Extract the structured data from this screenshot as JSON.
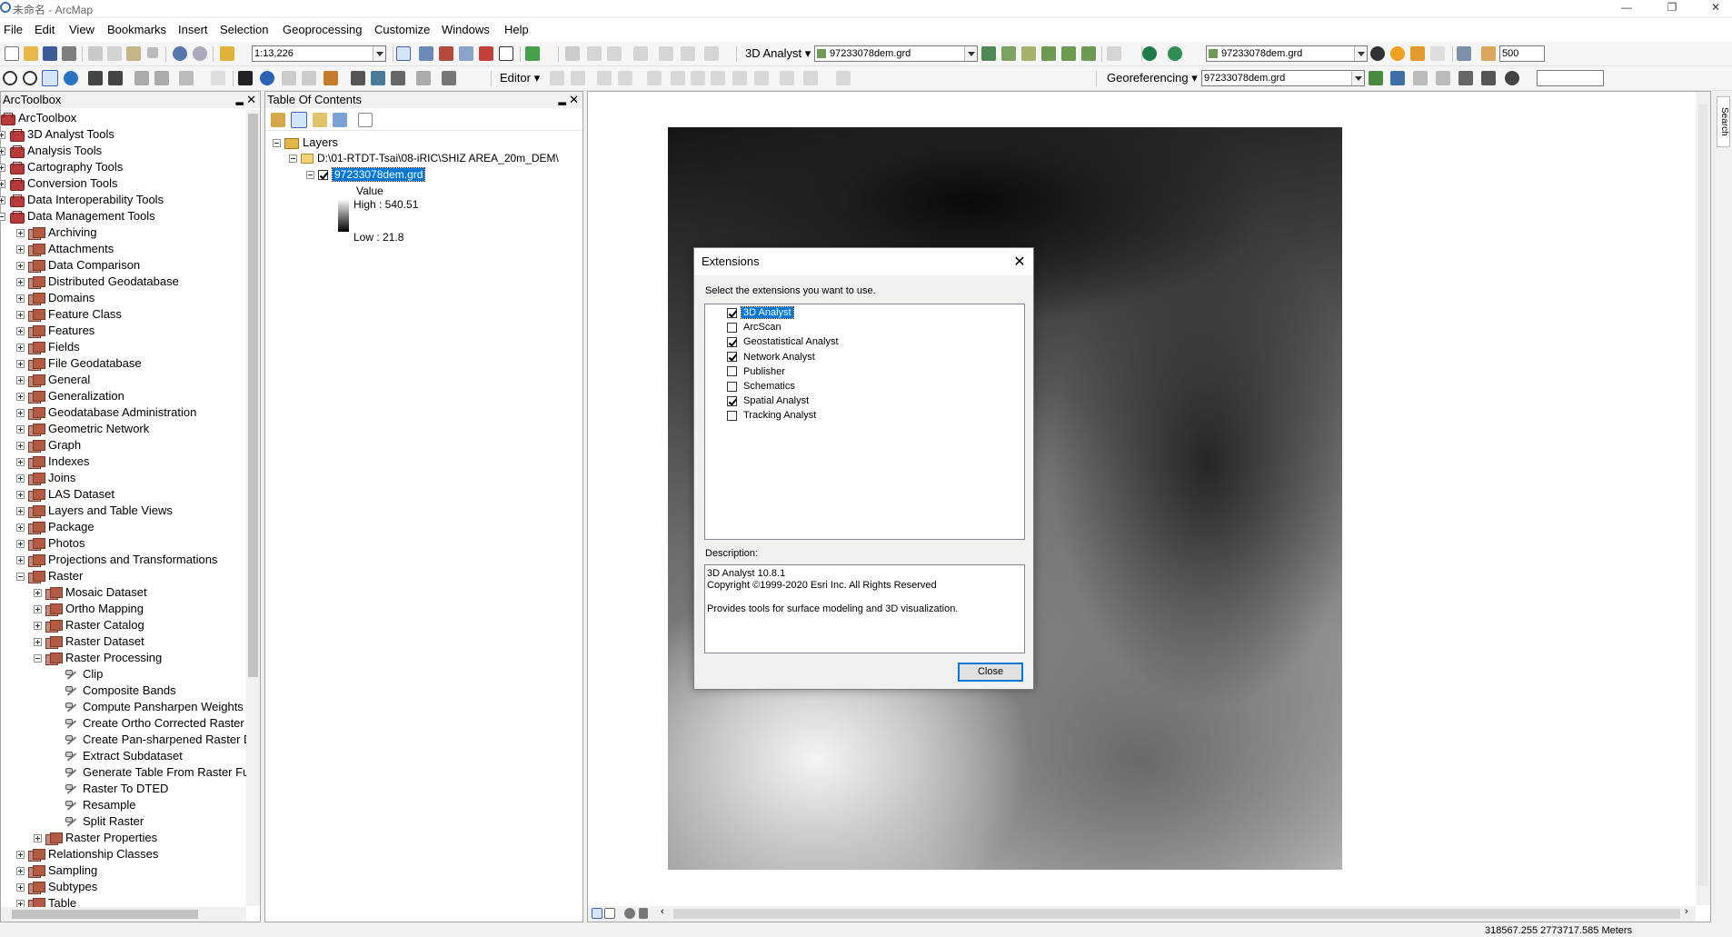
{
  "window": {
    "title": "未命名 - ArcMap",
    "controls": [
      "—",
      "❐",
      "✕"
    ]
  },
  "menu": [
    "File",
    "Edit",
    "View",
    "Bookmarks",
    "Insert",
    "Selection",
    "Geoprocessing",
    "Customize",
    "Windows",
    "Help"
  ],
  "toolbar": {
    "scale": "1:13,226",
    "analyst_label": "3D Analyst",
    "analyst_layer": "97233078dem.grd",
    "spatial_layer": "97233078dem.grd",
    "resolution": "500",
    "editor_label": "Editor",
    "georef_label": "Georeferencing",
    "georef_layer": "97233078dem.grd"
  },
  "toolbox": {
    "title": "ArcToolbox",
    "root": "ArcToolbox",
    "top_items": [
      "3D Analyst Tools",
      "Analysis Tools",
      "Cartography Tools",
      "Conversion Tools",
      "Data Interoperability Tools",
      "Data Management Tools"
    ],
    "dm_items_before_raster": [
      "Archiving",
      "Attachments",
      "Data Comparison",
      "Distributed Geodatabase",
      "Domains",
      "Feature Class",
      "Features",
      "Fields",
      "File Geodatabase",
      "General",
      "Generalization",
      "Geodatabase Administration",
      "Geometric Network",
      "Graph",
      "Indexes",
      "Joins",
      "LAS Dataset",
      "Layers and Table Views",
      "Package",
      "Photos",
      "Projections and Transformations"
    ],
    "raster": "Raster",
    "raster_items": [
      "Mosaic Dataset",
      "Ortho Mapping",
      "Raster Catalog",
      "Raster Dataset"
    ],
    "raster_processing": "Raster Processing",
    "rp_tools": [
      "Clip",
      "Composite Bands",
      "Compute Pansharpen Weights",
      "Create Ortho Corrected Raster I",
      "Create Pan-sharpened Raster D",
      "Extract Subdataset",
      "Generate Table From Raster Fu",
      "Raster To DTED",
      "Resample",
      "Split Raster"
    ],
    "raster_after": [
      "Raster Properties"
    ],
    "dm_items_after": [
      "Relationship Classes",
      "Sampling",
      "Subtypes",
      "Table"
    ]
  },
  "toc": {
    "title": "Table Of Contents",
    "layers": "Layers",
    "folder": "D:\\01-RTDT-Tsai\\08-iRIC\\SHIZ AREA_20m_DEM\\",
    "layer_name": "97233078dem.grd",
    "value_label": "Value",
    "high": "High : 540.51",
    "low": "Low : 21.8"
  },
  "dialog": {
    "title": "Extensions",
    "prompt": "Select the extensions you want to use.",
    "extensions": [
      {
        "name": "3D Analyst",
        "checked": true,
        "selected": true
      },
      {
        "name": "ArcScan",
        "checked": false,
        "selected": false
      },
      {
        "name": "Geostatistical Analyst",
        "checked": true,
        "selected": false
      },
      {
        "name": "Network Analyst",
        "checked": true,
        "selected": false
      },
      {
        "name": "Publisher",
        "checked": false,
        "selected": false
      },
      {
        "name": "Schematics",
        "checked": false,
        "selected": false
      },
      {
        "name": "Spatial Analyst",
        "checked": true,
        "selected": false
      },
      {
        "name": "Tracking Analyst",
        "checked": false,
        "selected": false
      }
    ],
    "desc_label": "Description:",
    "desc_lines": [
      "3D Analyst 10.8.1",
      "Copyright ©1999-2020 Esri Inc. All Rights Reserved",
      "",
      "Provides tools for surface modeling and 3D visualization."
    ],
    "close": "Close"
  },
  "search_tab": "Search",
  "status": {
    "coords": "318567.255  2773717.585 Meters"
  }
}
